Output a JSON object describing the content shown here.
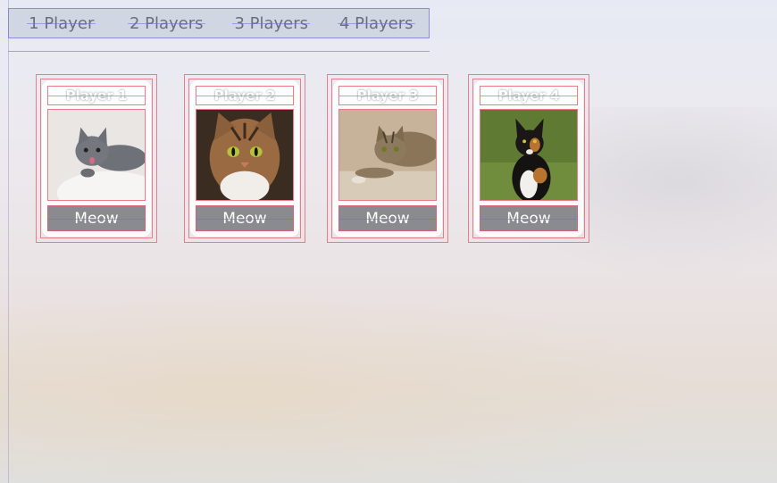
{
  "segments": [
    "1 Player",
    "2 Players",
    "3 Players",
    "4 Players"
  ],
  "players": [
    {
      "name": "Player 1",
      "button": "Meow",
      "photo_icon": "cat-photo-gray-kitten"
    },
    {
      "name": "Player 2",
      "button": "Meow",
      "photo_icon": "cat-photo-tabby"
    },
    {
      "name": "Player 3",
      "button": "Meow",
      "photo_icon": "cat-photo-striped"
    },
    {
      "name": "Player 4",
      "button": "Meow",
      "photo_icon": "cat-photo-calico"
    }
  ]
}
